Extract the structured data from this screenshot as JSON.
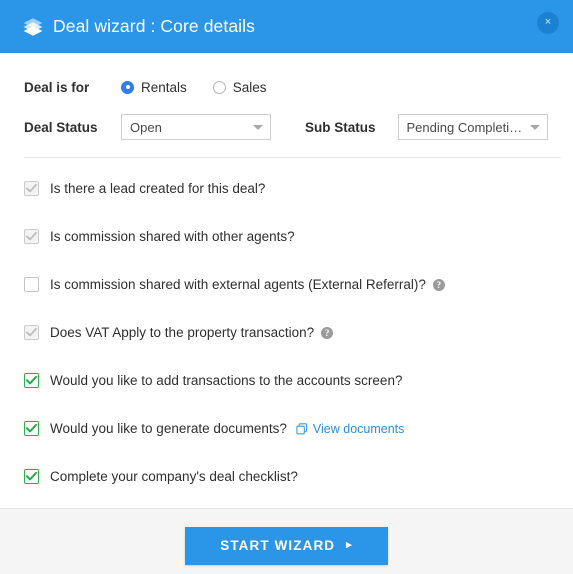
{
  "header": {
    "icon": "layers-diamond-icon",
    "title": "Deal wizard : Core details",
    "close_label": "×",
    "bg_color": "#2b96e8"
  },
  "form": {
    "deal_is_for": {
      "label": "Deal is for",
      "options": [
        {
          "label": "Rentals",
          "selected": true
        },
        {
          "label": "Sales",
          "selected": false
        }
      ]
    },
    "deal_status": {
      "label": "Deal Status",
      "value": "Open"
    },
    "sub_status": {
      "label": "Sub Status",
      "value": "Pending Completion"
    }
  },
  "checklist": {
    "items": [
      {
        "label": "Is there a lead created for this deal?",
        "state": "checked-disabled",
        "help": false
      },
      {
        "label": "Is commission shared with other agents?",
        "state": "checked-disabled",
        "help": false
      },
      {
        "label": "Is commission shared with external agents (External Referral)?",
        "state": "unchecked",
        "help": true,
        "help_label": "?"
      },
      {
        "label": "Does VAT Apply to the property transaction?",
        "state": "checked-disabled",
        "help": true,
        "help_label": "?"
      },
      {
        "label": "Would you like to add transactions to the accounts screen?",
        "state": "checked-green",
        "help": false
      },
      {
        "label": "Would you like to generate documents?",
        "state": "checked-green",
        "help": false,
        "link": {
          "label": "View documents",
          "icon": "copy-documents-icon"
        }
      },
      {
        "label": "Complete your company's deal checklist?",
        "state": "checked-green",
        "help": false
      }
    ]
  },
  "footer": {
    "start_label": "START WIZARD",
    "start_arrow": "▸",
    "accent_color": "#2b96e8"
  },
  "colors": {
    "accent_blue": "#2b96e8",
    "radio_blue": "#2f7eea",
    "green": "#2eab4e",
    "link_blue": "#2b8fe0",
    "footer_bg": "#f5f5f5"
  }
}
